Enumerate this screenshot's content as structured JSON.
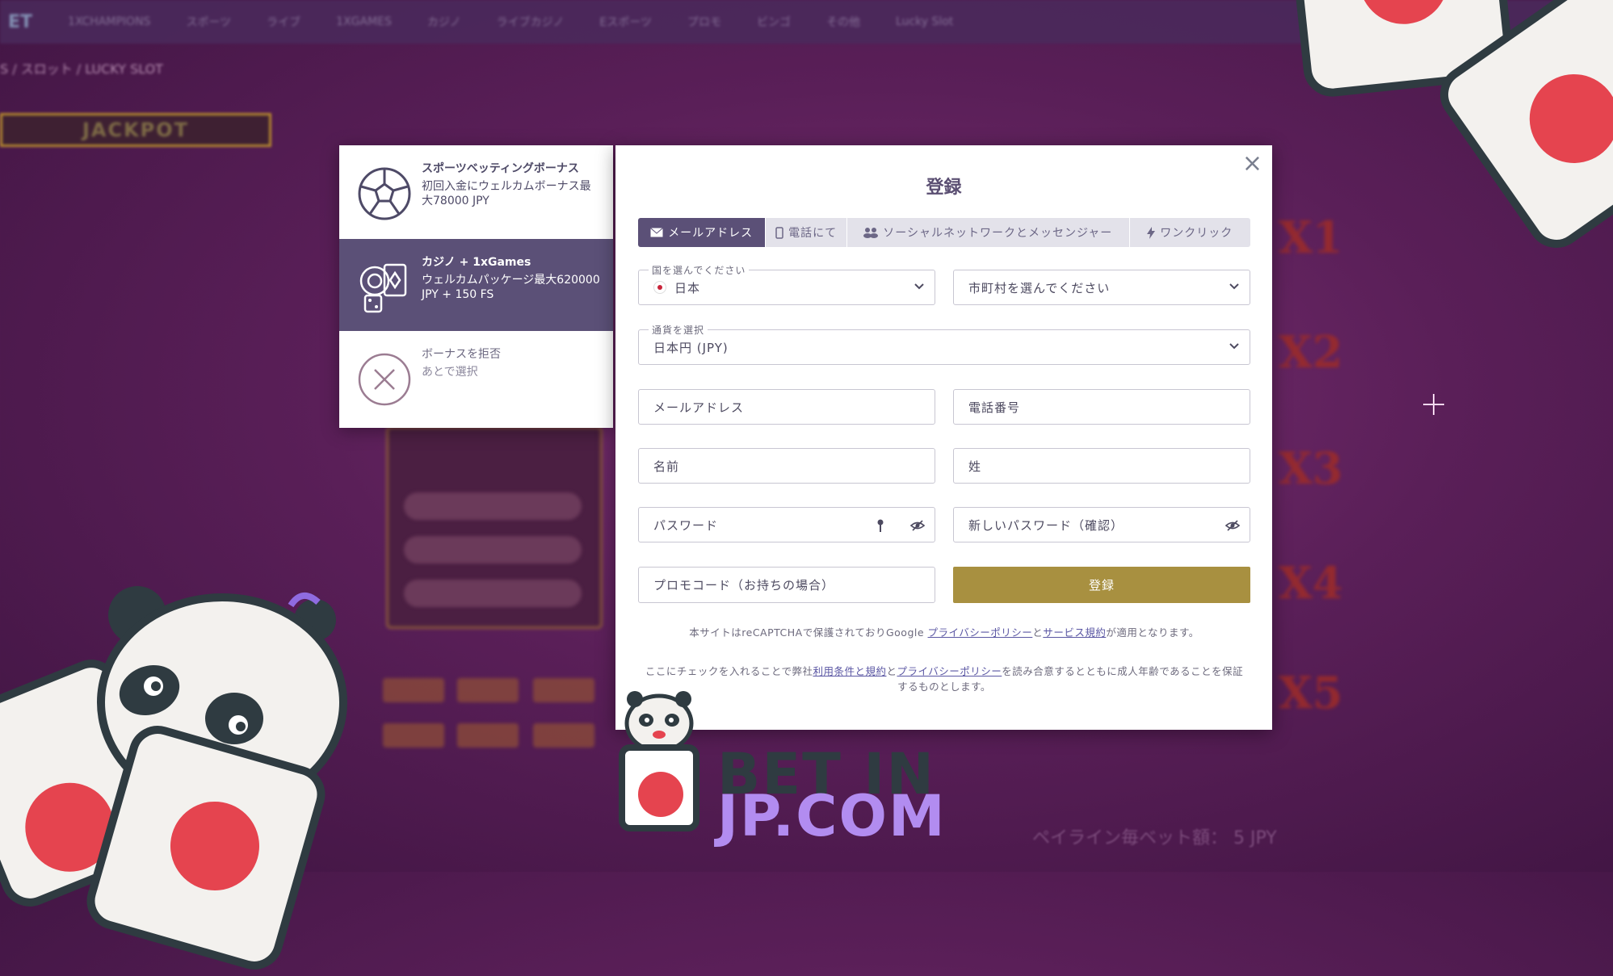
{
  "background": {
    "brand": "ET",
    "nav": [
      "1XCHAMPIONS",
      "スポーツ",
      "ライブ",
      "1XGAMES",
      "カジノ",
      "ライブカジノ",
      "Eスポーツ",
      "プロモ",
      "ビンゴ",
      "その他",
      "Lucky Slot"
    ],
    "breadcrumb": "S / スロット / LUCKY SLOT",
    "jackpot": "JACKPOT",
    "multipliers": [
      "X1",
      "X2",
      "X3",
      "X4",
      "X5"
    ],
    "payline_text": "ペイライン毎ベット額： 5 JPY"
  },
  "bonus": {
    "options": [
      {
        "title": "スポーツベッティングボーナス",
        "desc": "初回入金にウェルカムボーナス最大78000 JPY"
      },
      {
        "title": "カジノ + 1xGames",
        "desc": "ウェルカムパッケージ最大620000 JPY + 150 FS"
      },
      {
        "title": "ボーナスを拒否",
        "desc": "あとで選択"
      }
    ],
    "selected_index": 1
  },
  "modal": {
    "title": "登録",
    "close": "×",
    "tabs": [
      "メールアドレス",
      "電話にて",
      "ソーシャルネットワークとメッセンジャー",
      "ワンクリック"
    ],
    "active_tab": 0,
    "country": {
      "label": "国を選んでください",
      "value": "日本"
    },
    "city": {
      "placeholder": "市町村を選んでください"
    },
    "currency": {
      "label": "通貨を選択",
      "value": "日本円 (JPY)"
    },
    "email": {
      "placeholder": "メールアドレス"
    },
    "phone": {
      "placeholder": "電話番号"
    },
    "first_name": {
      "placeholder": "名前"
    },
    "last_name": {
      "placeholder": "姓"
    },
    "password": {
      "placeholder": "パスワード"
    },
    "password_confirm": {
      "placeholder": "新しいパスワード（確認）"
    },
    "promo": {
      "placeholder": "プロモコード（お持ちの場合）"
    },
    "submit_label": "登録",
    "recaptcha": {
      "pre": "本サイトはreCAPTCHAで保護されておりGoogle ",
      "privacy": "プライバシーポリシー",
      "and": "と",
      "terms": "サービス規約",
      "post": "が適用となります。"
    },
    "consent": {
      "pre": "ここにチェックを入れることで弊社",
      "terms": "利用条件と規約",
      "and": "と",
      "privacy": "プライバシーポリシー",
      "post": "を読み合意するとともに成人年齢であることを保証するものとします。"
    }
  },
  "watermark": {
    "line1": "BET IN",
    "line2": "JP.COM"
  },
  "colors": {
    "accent": "#5b5077",
    "submit": "#a89040",
    "card_dot": "#e5444f"
  }
}
